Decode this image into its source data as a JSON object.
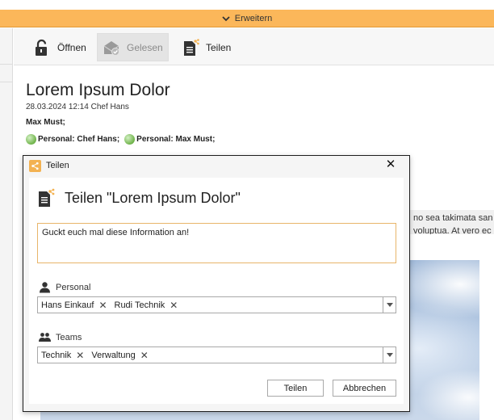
{
  "expand_bar": {
    "label": "Erweitern"
  },
  "toolbar": {
    "open_label": "Öffnen",
    "read_label": "Gelesen",
    "share_label": "Teilen"
  },
  "message": {
    "title": "Lorem Ipsum Dolor",
    "meta": "28.03.2024 12:14 Chef Hans",
    "to": "Max Must;",
    "shared_with": [
      {
        "group": "Personal:",
        "name": "Chef Hans;"
      },
      {
        "group": "Personal:",
        "name": "Max Must;"
      }
    ],
    "body_lines": [
      "no sea takimata san",
      "voluptua. At vero ec"
    ]
  },
  "dialog": {
    "window_title": "Teilen",
    "close_glyph": "✕",
    "heading": "Teilen \"Lorem Ipsum Dolor\"",
    "message_text": "Guckt euch mal diese Information an!",
    "personal_label": "Personal",
    "personal_tags": [
      "Hans Einkauf",
      "Rudi Technik"
    ],
    "teams_label": "Teams",
    "team_tags": [
      "Technik",
      "Verwaltung"
    ],
    "remove_glyph": "✕",
    "share_button": "Teilen",
    "cancel_button": "Abbrechen"
  },
  "colors": {
    "expand_bar": "#fbb75a",
    "accent_orange": "#f3b252",
    "presence_green": "#6fb34a"
  },
  "icons": [
    "chevron-down-icon",
    "unlock-icon",
    "envelope-read-icon",
    "share-document-icon",
    "presence-icon",
    "close-icon",
    "person-icon",
    "team-icon",
    "dropdown-arrow-icon"
  ]
}
